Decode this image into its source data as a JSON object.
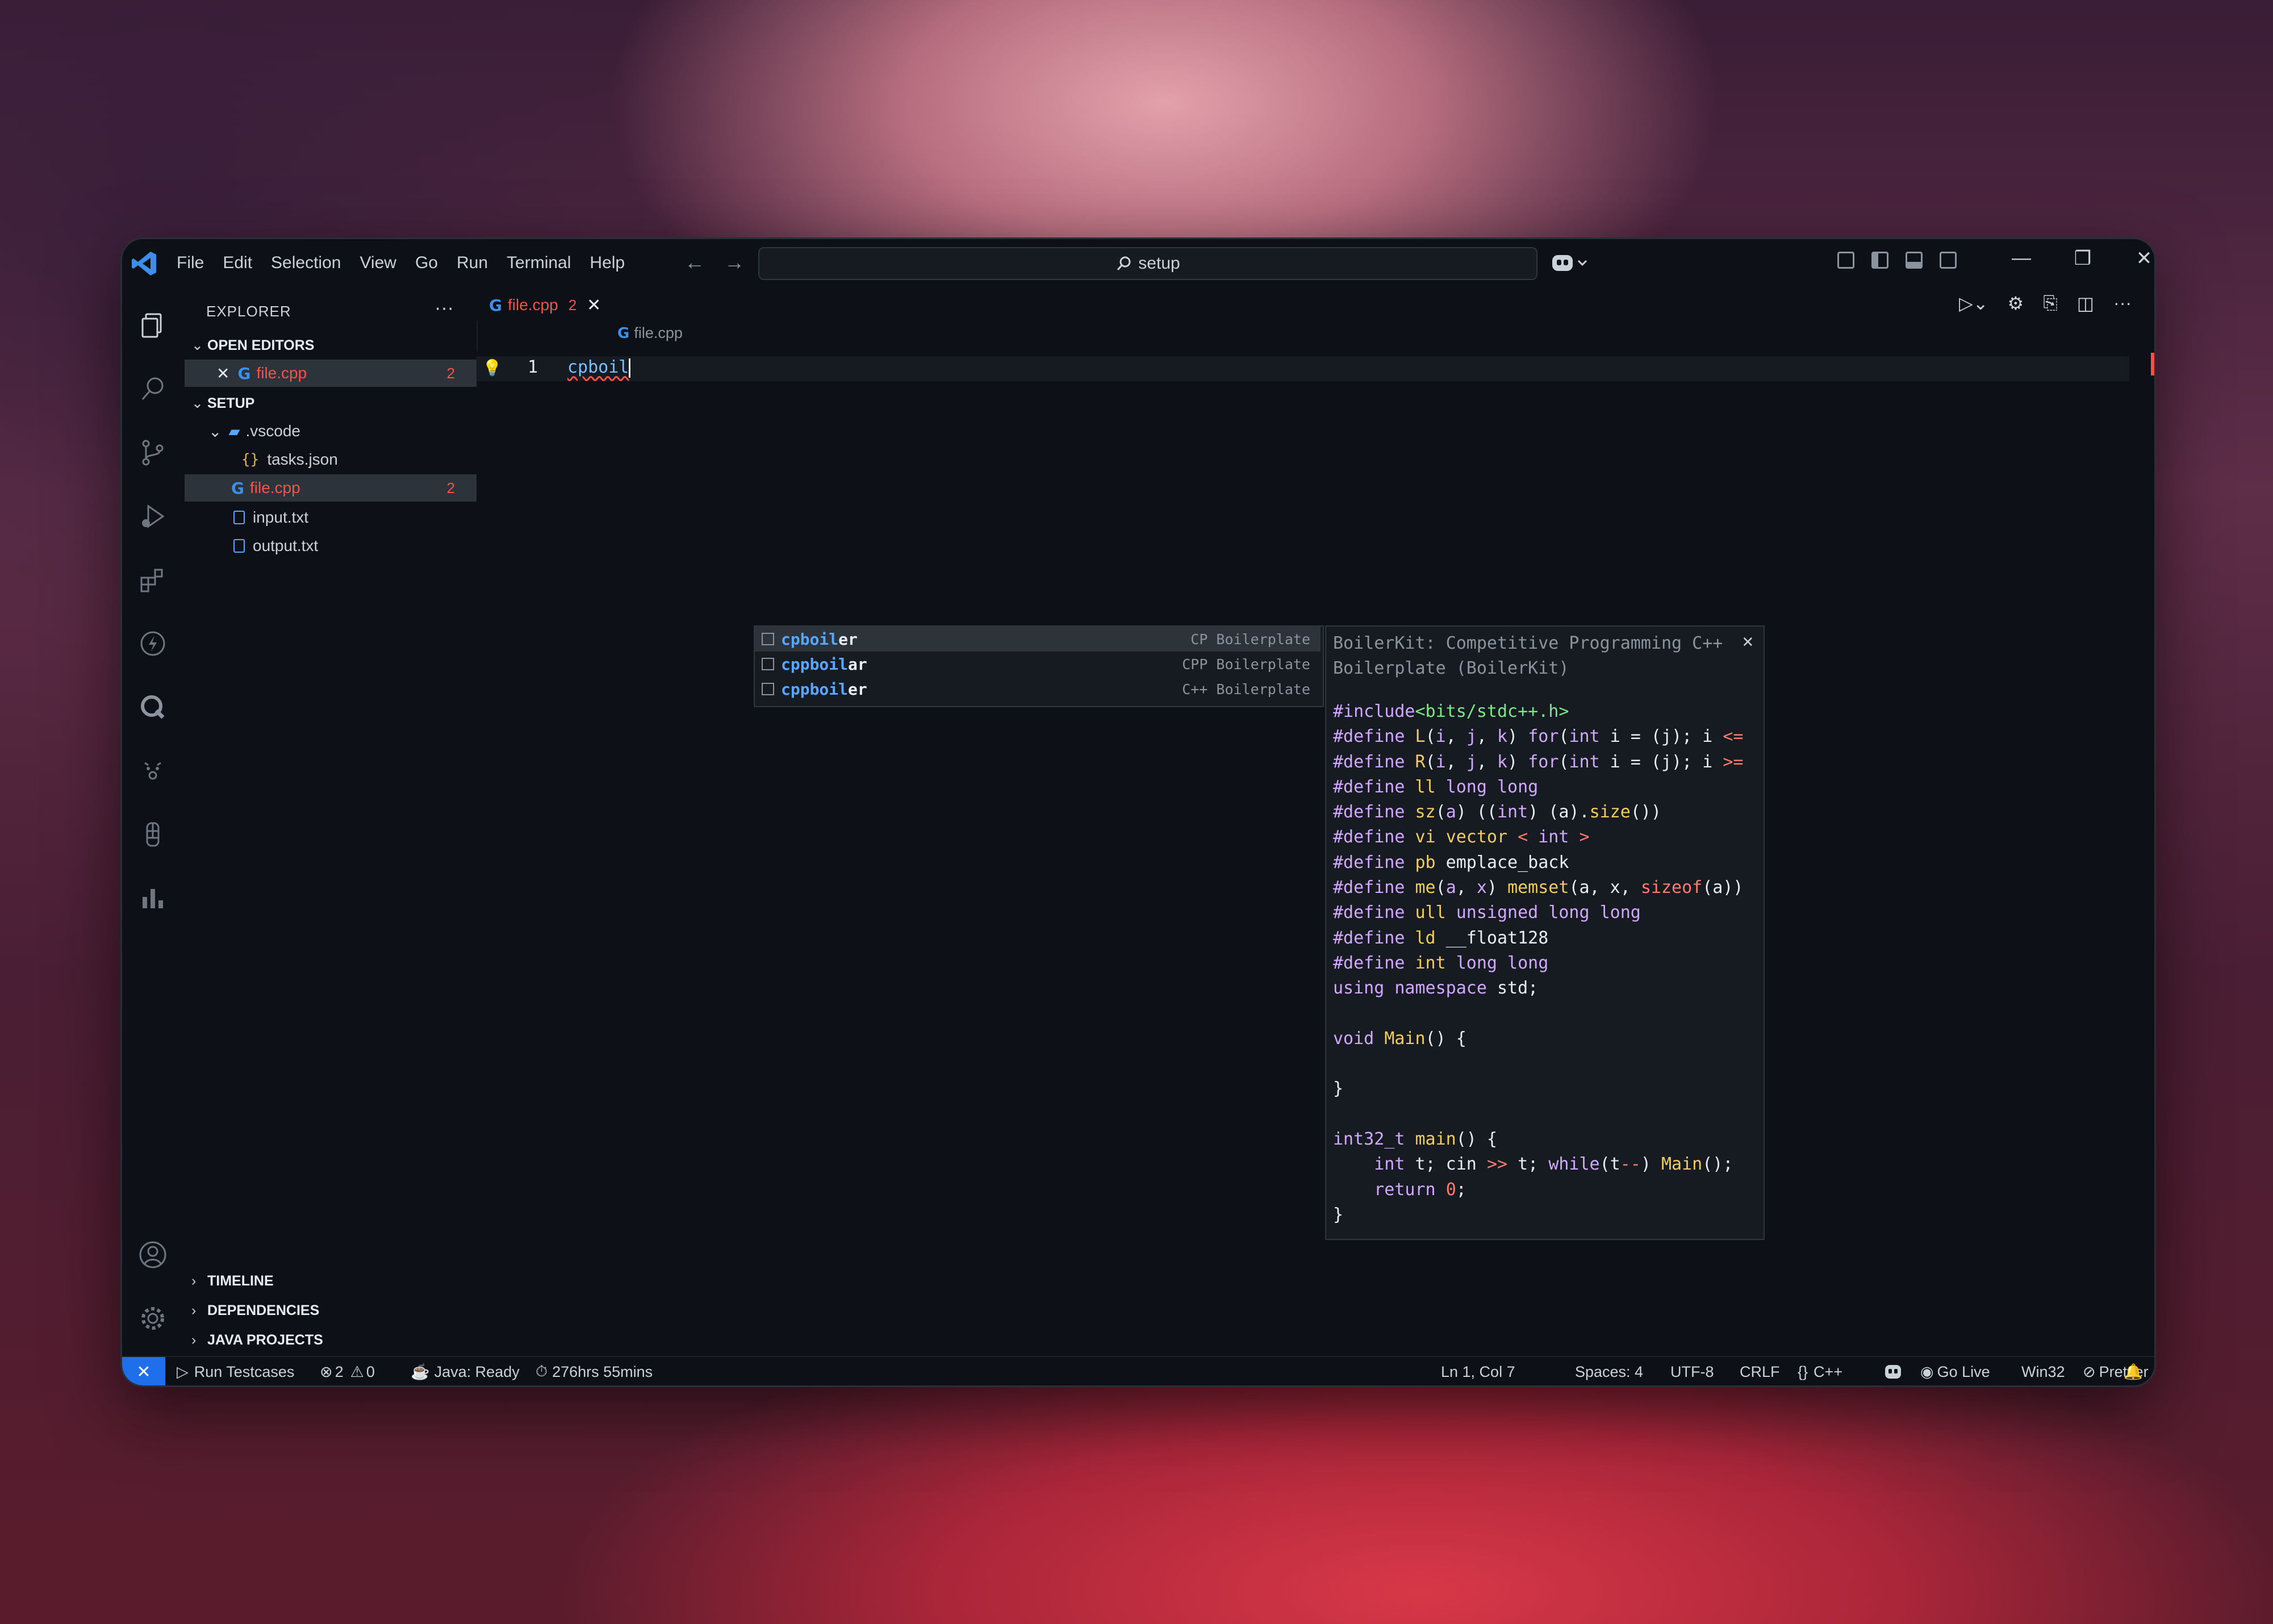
{
  "menu": [
    "File",
    "Edit",
    "Selection",
    "View",
    "Go",
    "Run",
    "Terminal",
    "Help"
  ],
  "search": {
    "text": "setup"
  },
  "sidebar": {
    "title": "EXPLORER",
    "open_editors_label": "OPEN EDITORS",
    "open_editor": {
      "name": "file.cpp",
      "problems": "2"
    },
    "workspace_label": "SETUP",
    "tree": {
      "vscode_folder": ".vscode",
      "tasks": "tasks.json",
      "file_cpp": {
        "name": "file.cpp",
        "problems": "2"
      },
      "input": "input.txt",
      "output": "output.txt"
    },
    "bottom_sections": [
      "TIMELINE",
      "DEPENDENCIES",
      "JAVA PROJECTS"
    ]
  },
  "tab": {
    "name": "file.cpp",
    "problems": "2"
  },
  "breadcrumb": "file.cpp",
  "editor": {
    "line_number": "1",
    "text": "cpboil"
  },
  "suggestions": [
    {
      "match": "cpboil",
      "rest": "er",
      "detail": "CP Boilerplate"
    },
    {
      "match": "cppboil",
      "rest": "ar",
      "detail": "CPP Boilerplate"
    },
    {
      "match": "cppboil",
      "rest": "er",
      "detail": "C++ Boilerplate"
    }
  ],
  "docs": {
    "title": "BoilerKit: Competitive Programming C++ Boilerplate (BoilerKit)"
  },
  "status": {
    "run_testcases": "Run Testcases",
    "errors": "2",
    "warnings": "0",
    "java": "Java: Ready",
    "time": "276hrs 55mins",
    "position": "Ln 1, Col 7",
    "spaces": "Spaces: 4",
    "encoding": "UTF-8",
    "eol": "CRLF",
    "language": "C++",
    "go_live": "Go Live",
    "platform": "Win32",
    "prettier": "Prettier"
  },
  "colors": {
    "accent": "#1f6feb",
    "error": "#f85149",
    "keyword": "#d2a8ff",
    "function": "#f2cc60",
    "string": "#7ee787"
  }
}
